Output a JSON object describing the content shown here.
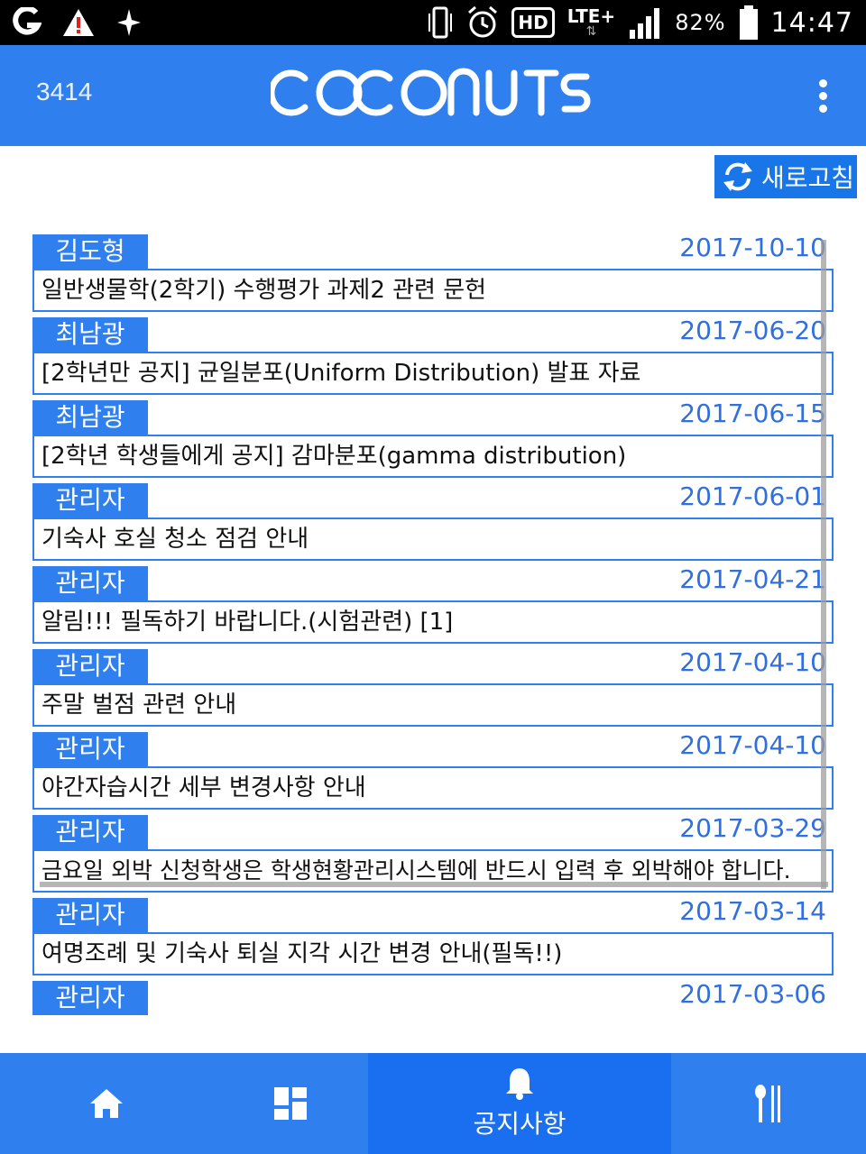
{
  "status_bar": {
    "battery": "82%",
    "time": "14:47",
    "network": "LTE+",
    "hd": "HD",
    "icons": [
      "g-logo-icon",
      "warning-icon",
      "sparkle-icon",
      "vibrate-icon",
      "alarm-icon",
      "hd-icon",
      "lte-icon",
      "signal-icon",
      "battery-icon"
    ]
  },
  "header": {
    "user_number": "3414",
    "logo": "COCONUTS",
    "menu_icon": "more-vert-icon"
  },
  "refresh": {
    "label": "새로고침",
    "icon": "refresh-icon"
  },
  "notices": [
    {
      "author": "김도형",
      "date": "2017-10-10",
      "title": "일반생물학(2학기) 수행평가 과제2 관련 문헌"
    },
    {
      "author": "최남광",
      "date": "2017-06-20",
      "title": "[2학년만 공지] 균일분포(Uniform Distribution) 발표 자료"
    },
    {
      "author": "최남광",
      "date": "2017-06-15",
      "title": "[2학년 학생들에게 공지] 감마분포(gamma distribution)"
    },
    {
      "author": "관리자",
      "date": "2017-06-01",
      "title": "기숙사 호실 청소 점검 안내"
    },
    {
      "author": "관리자",
      "date": "2017-04-21",
      "title": "알림!!! 필독하기 바랍니다.(시험관련)  [1]"
    },
    {
      "author": "관리자",
      "date": "2017-04-10",
      "title": "주말 벌점 관련 안내"
    },
    {
      "author": "관리자",
      "date": "2017-04-10",
      "title": "야간자습시간 세부 변경사항 안내"
    },
    {
      "author": "관리자",
      "date": "2017-03-29",
      "title": "금요일 외박 신청학생은 학생현황관리시스템에 반드시 입력 후 외박해야 합니다."
    },
    {
      "author": "관리자",
      "date": "2017-03-14",
      "title": "여명조례 및 기숙사 퇴실 지각 시간 변경 안내(필독!!)"
    },
    {
      "author": "관리자",
      "date": "2017-03-06",
      "title": ""
    }
  ],
  "bottom_nav": {
    "home_icon": "home-icon",
    "dashboard_icon": "dashboard-icon",
    "notice_label": "공지사항",
    "notice_icon": "bell-icon",
    "meal_icon": "utensils-icon"
  },
  "colors": {
    "primary": "#2f80ee",
    "active_tab": "#1a6ff0",
    "date_text": "#2f6fe0"
  }
}
